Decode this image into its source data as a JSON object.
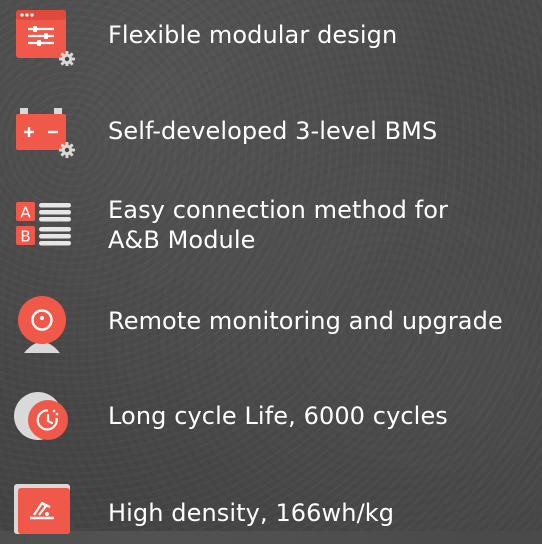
{
  "features": [
    {
      "label": "Flexible modular design",
      "icon": "settings-window-icon"
    },
    {
      "label": "Self-developed 3-level BMS",
      "icon": "battery-gear-icon"
    },
    {
      "label_line1": "Easy connection method for",
      "label_line2": "A&B Module",
      "icon": "ab-module-icon",
      "badge_a": "A",
      "badge_b": "B"
    },
    {
      "label": "Remote monitoring and upgrade",
      "icon": "webcam-icon"
    },
    {
      "label": "Long cycle Life, 6000 cycles",
      "icon": "cycle-clock-icon"
    },
    {
      "label": "High density, 166wh/kg",
      "icon": "density-scale-icon"
    }
  ],
  "colors": {
    "accent": "#f0584a",
    "accent_light": "#ff7a6a",
    "secondary": "#d9d9d9",
    "text": "#ffffff"
  }
}
